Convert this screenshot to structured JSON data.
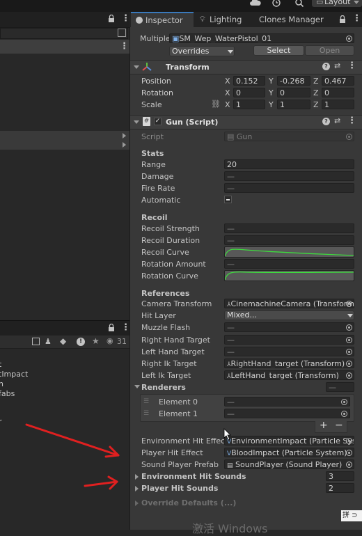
{
  "topbar": {
    "layout_label": "Layout"
  },
  "tabs": [
    {
      "label": "Inspector"
    },
    {
      "label": "Lighting"
    },
    {
      "label": "Clones Manager"
    }
  ],
  "header": {
    "multiple_label": "Multiple",
    "object_name": "SM_Wep_WaterPistol_01",
    "overrides_label": "Overrides",
    "select_label": "Select",
    "open_label": "Open"
  },
  "transform": {
    "title": "Transform",
    "position": {
      "label": "Position",
      "x": "0.152",
      "y": "-0.268",
      "z": "0.467"
    },
    "rotation": {
      "label": "Rotation",
      "x": "0",
      "y": "0",
      "z": "0"
    },
    "scale": {
      "label": "Scale",
      "x": "1",
      "y": "1",
      "z": "1"
    },
    "axis_x": "X",
    "axis_y": "Y",
    "axis_z": "Z"
  },
  "gun": {
    "title": "Gun (Script)",
    "script_label": "Script",
    "script_value": "Gun",
    "stats_header": "Stats",
    "range_label": "Range",
    "range_value": "20",
    "damage_label": "Damage",
    "fire_rate_label": "Fire Rate",
    "automatic_label": "Automatic",
    "recoil_header": "Recoil",
    "recoil_strength_label": "Recoil Strength",
    "recoil_duration_label": "Recoil Duration",
    "recoil_curve_label": "Recoil Curve",
    "rotation_amount_label": "Rotation Amount",
    "rotation_curve_label": "Rotation Curve",
    "references_header": "References",
    "camera_transform_label": "Camera Transform",
    "camera_transform_value": "CinemachineCamera (Transform",
    "hit_layer_label": "Hit Layer",
    "hit_layer_value": "Mixed...",
    "muzzle_flash_label": "Muzzle Flash",
    "right_hand_target_label": "Right Hand Target",
    "left_hand_target_label": "Left Hand Target",
    "right_ik_label": "Right Ik Target",
    "right_ik_value": "RightHand_target (Transform)",
    "left_ik_label": "Left Ik Target",
    "left_ik_value": "LeftHand_target (Transform)",
    "renderers_label": "Renderers",
    "element0_label": "Element 0",
    "element1_label": "Element 1",
    "add_label": "+",
    "remove_label": "−",
    "env_hit_effect_label": "Environment Hit Effect",
    "env_hit_effect_value": "EnvironmentImpact (Particle Sys",
    "player_hit_effect_label": "Player Hit Effect",
    "player_hit_effect_value": "BloodImpact (Particle System)",
    "sound_player_prefab_label": "Sound Player Prefab",
    "sound_player_prefab_value": "SoundPlayer (Sound Player)",
    "env_hit_sounds_label": "Environment Hit Sounds",
    "env_hit_sounds_count": "3",
    "player_hit_sounds_label": "Player Hit Sounds",
    "player_hit_sounds_count": "2",
    "override_defaults_label": "Override Defaults (...)",
    "dash": "—"
  },
  "left_panel": {
    "counter": "31",
    "items": [
      "t",
      "tImpact",
      "n",
      "fabs",
      "r"
    ]
  },
  "watermark": "激活 Windows",
  "colors": {
    "accent": "#3a79bb",
    "curve": "#3ddc3d",
    "arrow": "#e02020"
  }
}
